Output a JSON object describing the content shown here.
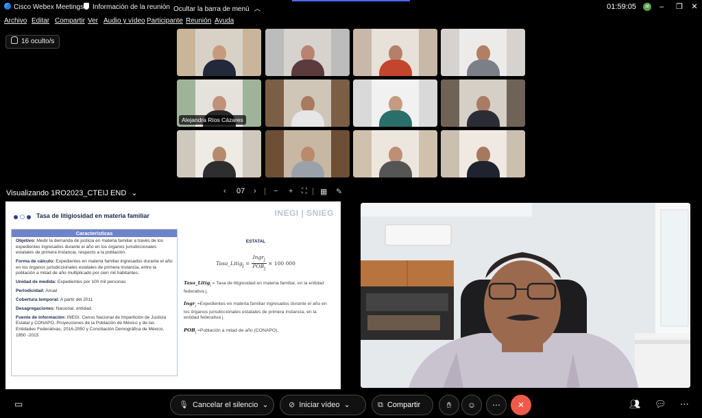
{
  "titlebar": {
    "app_title": "Cisco Webex Meetings",
    "meeting_info": "Información de la reunión",
    "hide_menu": "Ocultar la barra de menú",
    "clock": "01:59:05",
    "avatar_initials": "al"
  },
  "menu": [
    "Archivo",
    "Editar",
    "Compartir",
    "Ver",
    "Audio y vídeo",
    "Participante",
    "Reunión",
    "Ayuda"
  ],
  "hidden_participants": "16 oculto/s",
  "tiles": [
    {
      "room": "#c9b59a",
      "wall": "#d8d2c6",
      "skin": "#c89a7c",
      "shirt": "#222a3a"
    },
    {
      "room": "#bcbcbc",
      "wall": "#d6d3cf",
      "skin": "#b88470",
      "shirt": "#5b3b3b"
    },
    {
      "room": "#c7b8a8",
      "wall": "#e7e1da",
      "skin": "#b4806a",
      "shirt": "#c2452e"
    },
    {
      "room": "#d5d2cf",
      "wall": "#ecebe9",
      "skin": "#b27f64",
      "shirt": "#7a7f88"
    },
    {
      "room": "#9fb39a",
      "wall": "#e5e2dc",
      "skin": "#c1917a",
      "shirt": "#2a2a2a",
      "name": "Alejandra Ríos Cázares"
    },
    {
      "room": "#7b5f45",
      "wall": "#cfc6b8",
      "skin": "#a87a60",
      "shirt": "#e6e6e6"
    },
    {
      "room": "#d9d9d9",
      "wall": "#f1f1f1",
      "skin": "#c59a82",
      "shirt": "#2a6f6a"
    },
    {
      "room": "#6f6357",
      "wall": "#d5cfc5",
      "skin": "#a87b62",
      "shirt": "#2c2c36"
    },
    {
      "room": "#cfc8bc",
      "wall": "#eeeae4",
      "skin": "#b58a6e",
      "shirt": "#2e2e2e"
    },
    {
      "room": "#6d4f36",
      "wall": "#c7b7a3",
      "skin": "#b98a6d",
      "shirt": "#9ba1aa"
    },
    {
      "room": "#d0c1ad",
      "wall": "#ece6de",
      "skin": "#bd8f75",
      "shirt": "#555"
    },
    {
      "room": "#cbbfb0",
      "wall": "#efe9e1",
      "skin": "#a57860",
      "shirt": "#1f2330"
    }
  ],
  "share": {
    "title": "Visualizando 1RO2023_CTEIJ END",
    "page": "07"
  },
  "slide": {
    "title": "Tasa de litigiosidad en materia familiar",
    "logo": "INEGI | SNIEG",
    "characteristics_header": "Características",
    "items": [
      {
        "label": "Objetivo:",
        "text": "Medir la demanda de justicia en materia familiar a través de los expedientes ingresados durante el año en los órganos jurisdiccionales estatales de primera instancia, respecto a la población."
      },
      {
        "label": "Forma de cálculo:",
        "text": "Expedientes en materia familiar ingresados durante el año en los órganos jurisdiccionales estatales de primera instancia, entre la población a mitad de año multiplicado por cien mil habitantes."
      },
      {
        "label": "Unidad de medida:",
        "text": "Expedientes por 100 mil personas"
      },
      {
        "label": "Periodicidad:",
        "text": "Anual"
      },
      {
        "label": "Cobertura temporal:",
        "text": "A partir del 2011"
      },
      {
        "label": "Desagregaciones:",
        "text": "Nacional, entidad."
      },
      {
        "label": "Fuente de información:",
        "text": "INEGI. Censo Nacional de Impartición de Justicia Estatal y CONAPO. Proyecciones de la Población de México y de las Entidades Federativas, 2016-2050 y Conciliación Demográfica de México, 1950 -2015"
      }
    ],
    "estatal": "ESTATAL",
    "formula_lhs": "Tasa_Litig",
    "formula_num": "Ingr",
    "formula_den": "POB",
    "formula_mult": "× 100 000",
    "defs": [
      {
        "sym": "Tasa_Litig",
        "text": "= Tasa de litigiosidad en materia familiar, en la entidad federativa j."
      },
      {
        "sym": "Ingr",
        "text": "=Expedientes en materia familiar ingresados durante el año en los órganos jurisdiccionales estatales de primera instancia, en la entidad federativa j."
      },
      {
        "sym": "POB",
        "text": "=Población a mitad de año (CONAPO)."
      }
    ]
  },
  "controls": {
    "mute": "Cancelar el silencio",
    "video": "Iniciar vídeo",
    "share": "Compartir"
  }
}
